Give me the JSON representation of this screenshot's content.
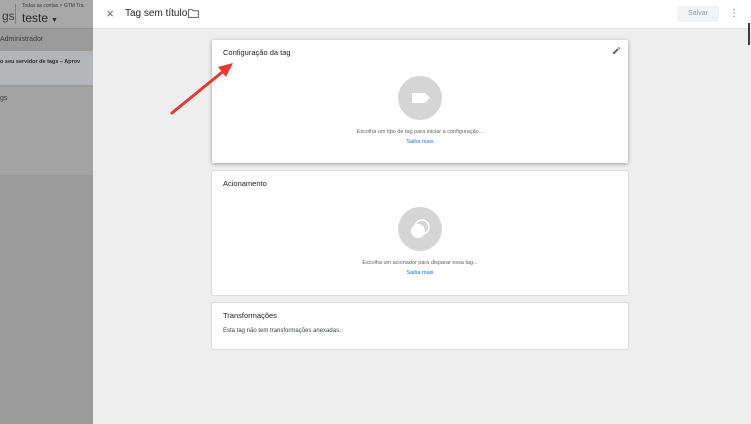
{
  "background": {
    "tags_label": "gs",
    "breadcrumb": "Todas as contas > GTM Tra",
    "account_name": "teste",
    "admin_label": "Administrador",
    "banner_text": "o seu servidor de tags – Aprov",
    "sidebar_item": "gs"
  },
  "header": {
    "close_label": "×",
    "title": "Tag sem título",
    "save_label": "Salvar",
    "more_label": "⋮"
  },
  "cards": {
    "config": {
      "title": "Configuração da tag",
      "hint": "Escolha um tipo de tag para iniciar a configuração...",
      "link": "Saiba mais"
    },
    "trigger": {
      "title": "Acionamento",
      "hint": "Escolha um acionador para disparar essa tag...",
      "link": "Saiba mais"
    },
    "transform": {
      "title": "Transformações",
      "text": "Esta tag não tem transformações anexadas."
    }
  },
  "colors": {
    "accent": "#1a73e8",
    "annotation_arrow": "#e53935"
  },
  "icons": [
    "close-icon",
    "folder-icon",
    "edit-icon",
    "tag-icon",
    "trigger-icon",
    "more-vert-icon"
  ]
}
